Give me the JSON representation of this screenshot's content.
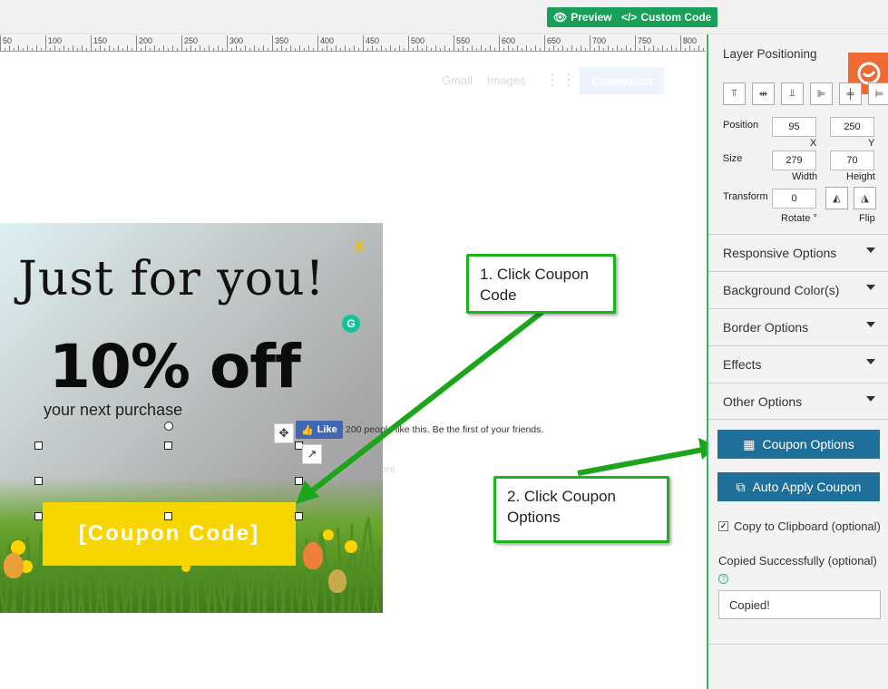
{
  "toolbar": {
    "preview_label": "Preview",
    "custom_code_label": "Custom Code",
    "accent": "#18a058"
  },
  "ruler": {
    "labels": [
      "50",
      "100",
      "150",
      "200",
      "250",
      "300",
      "350",
      "400",
      "450",
      "500",
      "550",
      "600",
      "650",
      "700",
      "750",
      "800"
    ]
  },
  "background_page": {
    "gmail": "Gmail",
    "images": "Images",
    "signin": "Connexion",
    "fragment": "ore"
  },
  "popup": {
    "close": "X",
    "headline": "Just for you!",
    "offer": "10% off",
    "subtext": "your next purchase",
    "coupon": "[Coupon Code]",
    "coupon_color": "#f7d600"
  },
  "facebook": {
    "like": "Like",
    "text": "200 people like this. Be the first of your friends."
  },
  "callouts": {
    "step1": "1. Click Coupon Code",
    "step2": "2. Click Coupon Options",
    "color": "#1cb31c"
  },
  "sidebar": {
    "title": "Layer Positioning",
    "position_label": "Position",
    "position_x": "95",
    "position_y": "250",
    "x_label": "X",
    "y_label": "Y",
    "size_label": "Size",
    "width": "279",
    "height": "70",
    "width_label": "Width",
    "height_label": "Height",
    "transform_label": "Transform",
    "rotate": "0",
    "rotate_label": "Rotate °",
    "flip_label": "Flip",
    "sections": [
      "Responsive Options",
      "Background Color(s)",
      "Border Options",
      "Effects",
      "Other Options"
    ],
    "coupon_options": "Coupon Options",
    "auto_apply": "Auto Apply Coupon",
    "copy_clipboard": "Copy to Clipboard (optional)",
    "copied_label": "Copied Successfully (optional)",
    "copied_value": "Copied!",
    "button_color": "#1f6f9b"
  }
}
